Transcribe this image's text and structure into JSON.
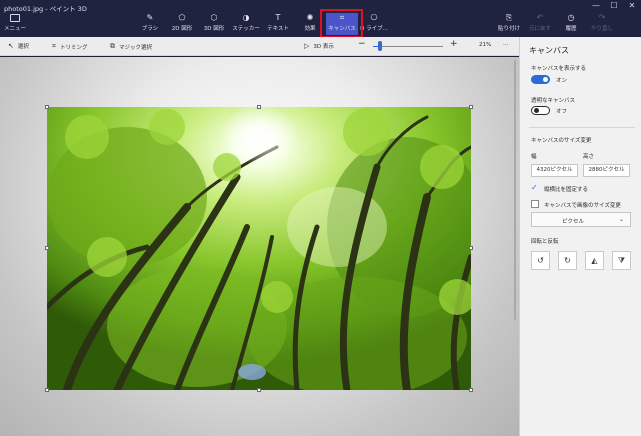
{
  "window": {
    "title": "photo01.jpg - ペイント 3D"
  },
  "window_controls": {
    "minimize": "—",
    "maximize": "☐",
    "close": "✕"
  },
  "menu": {
    "label": "メニュー"
  },
  "tools": [
    {
      "label": "ブラシ",
      "icon": "brush-icon",
      "glyph": "✎"
    },
    {
      "label": "2D 図形",
      "icon": "2d-shapes-icon",
      "glyph": "⬠"
    },
    {
      "label": "3D 図形",
      "icon": "3d-shapes-icon",
      "glyph": "⬡"
    },
    {
      "label": "ステッカー",
      "icon": "sticker-icon",
      "glyph": "◑"
    },
    {
      "label": "テキスト",
      "icon": "text-icon",
      "glyph": "T"
    },
    {
      "label": "効果",
      "icon": "effects-icon",
      "glyph": "✺"
    },
    {
      "label": "キャンバス",
      "icon": "canvas-icon",
      "glyph": "⌗",
      "active": true
    },
    {
      "label": "D ライブ...",
      "icon": "3d-library-icon",
      "glyph": "⎔"
    }
  ],
  "right_tools": [
    {
      "label": "貼り付け",
      "icon": "paste-icon",
      "glyph": "⎘"
    },
    {
      "label": "元に戻す",
      "icon": "undo-icon",
      "glyph": "↶",
      "disabled": true
    },
    {
      "label": "履歴",
      "icon": "history-icon",
      "glyph": "◷"
    },
    {
      "label": "やり直し",
      "icon": "redo-icon",
      "glyph": "↷",
      "disabled": true
    }
  ],
  "subtoolbar": {
    "select": "選択",
    "crop": "トリミング",
    "magic_select": "マジック選択",
    "view_3d": "3D 表示",
    "zoom_out": "−",
    "zoom_in": "+",
    "zoom_percent": "21%",
    "more": "···",
    "zoom_level": 0.1
  },
  "panel": {
    "title": "キャンバス",
    "show_canvas_label": "キャンバスを表示する",
    "show_canvas_state": "オン",
    "show_canvas_on": true,
    "transparent_label": "透明なキャンバス",
    "transparent_state": "オフ",
    "transparent_on": false,
    "resize_title": "キャンバスのサイズ変更",
    "width_label": "幅",
    "height_label": "高さ",
    "width_value": "4320ピクセル",
    "height_value": "2880ピクセル",
    "lock_aspect_label": "縦横比を固定する",
    "lock_aspect_checked": true,
    "resize_image_label": "キャンバスで画像のサイズ変更",
    "resize_image_checked": false,
    "unit_value": "ピクセル",
    "rotate_flip_title": "回転と反転",
    "rotate_buttons": [
      {
        "icon": "rotate-left-icon",
        "glyph": "↺"
      },
      {
        "icon": "rotate-right-icon",
        "glyph": "↻"
      },
      {
        "icon": "flip-horizontal-icon",
        "glyph": "◭"
      },
      {
        "icon": "flip-vertical-icon",
        "glyph": "⧩"
      }
    ]
  },
  "colors": {
    "titlebar": "#1f2340",
    "accent": "#2a6bd6",
    "active_tool": "#4a55c9",
    "highlight": "#e0102a",
    "photo_green": "#7fc322"
  }
}
